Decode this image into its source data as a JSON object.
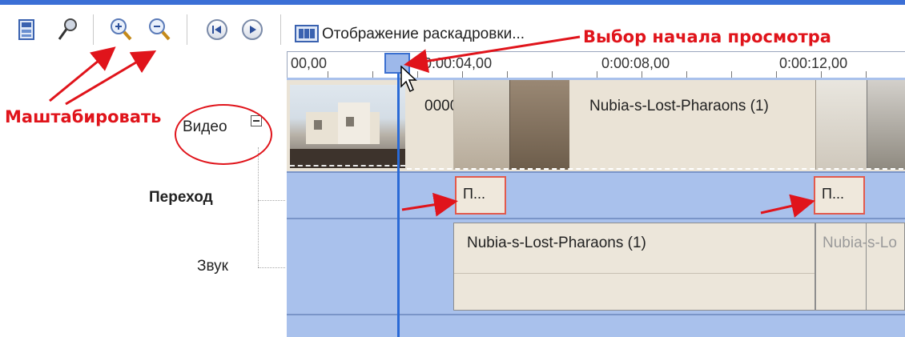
{
  "toolbar": {
    "storyboard_label": "Отображение раскадровки...",
    "icons": [
      "storyboard-icon",
      "narrate-icon",
      "zoom-in-icon",
      "zoom-out-icon",
      "rewind-icon",
      "play-icon"
    ]
  },
  "annotations": {
    "zoom": "Маштабировать",
    "start": "Выбор начала просмотра"
  },
  "ruler": {
    "ticks": [
      "00,00",
      "0:00:04,00",
      "0:00:08,00",
      "0:00:12,00"
    ]
  },
  "tracks": {
    "video": "Видео",
    "transition": "Переход",
    "audio": "Звук"
  },
  "clips": {
    "video_title_short": "0000",
    "video_title": "Nubia-s-Lost-Pharaons (1)",
    "transition_1": "П...",
    "transition_2": "П...",
    "audio_title": "Nubia-s-Lost-Pharaons (1)",
    "audio_title_2": "Nubia-s-Lo"
  },
  "colors": {
    "accent_blue": "#3b6fd6",
    "timeline_bg": "#a9c1ec",
    "annotation_red": "#e0141b"
  }
}
